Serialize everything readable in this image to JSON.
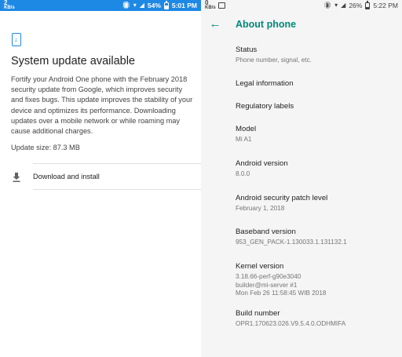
{
  "left": {
    "status_bar": {
      "speed_value": "2",
      "speed_unit": "KB/s",
      "battery_percent": "54%",
      "battery_level": 0.54,
      "time": "5:01 PM"
    },
    "icon": "system-update-icon",
    "title": "System update available",
    "body": "Fortify your Android One phone with the February 2018 security update from Google, which improves security and fixes bugs. This update improves the stability of your device and optimizes its performance. Downloading updates over a mobile network or while roaming may cause additional charges.",
    "update_size": "Update size: 87.3 MB",
    "download": {
      "icon": "download-icon",
      "label": "Download and install"
    }
  },
  "right": {
    "status_bar": {
      "speed_value": "0",
      "speed_unit": "KB/s",
      "battery_percent": "26%",
      "battery_level": 0.26,
      "time": "5:22 PM"
    },
    "app_bar": {
      "back_icon": "back-arrow-icon",
      "title": "About phone"
    },
    "items": [
      {
        "title": "Status",
        "sub": [
          "Phone number, signal, etc."
        ]
      },
      {
        "title": "Legal information",
        "sub": []
      },
      {
        "title": "Regulatory labels",
        "sub": []
      },
      {
        "title": "Model",
        "sub": [
          "Mi A1"
        ]
      },
      {
        "title": "Android version",
        "sub": [
          "8.0.0"
        ]
      },
      {
        "title": "Android security patch level",
        "sub": [
          "February 1, 2018"
        ]
      },
      {
        "title": "Baseband version",
        "sub": [
          "953_GEN_PACK-1.130033.1.131132.1"
        ]
      },
      {
        "title": "Kernel version",
        "sub": [
          "3.18.66-perf-g90e3040",
          "builder@mi-server #1",
          "Mon Feb 26 11:58:45 WIB 2018"
        ]
      },
      {
        "title": "Build number",
        "sub": [
          "OPR1.170623.026.V9.5.4.0.ODHMIFA"
        ]
      }
    ]
  },
  "colors": {
    "status_bar_left": "#1e88e5",
    "accent": "#00897b",
    "right_background": "#f5f5f5"
  }
}
